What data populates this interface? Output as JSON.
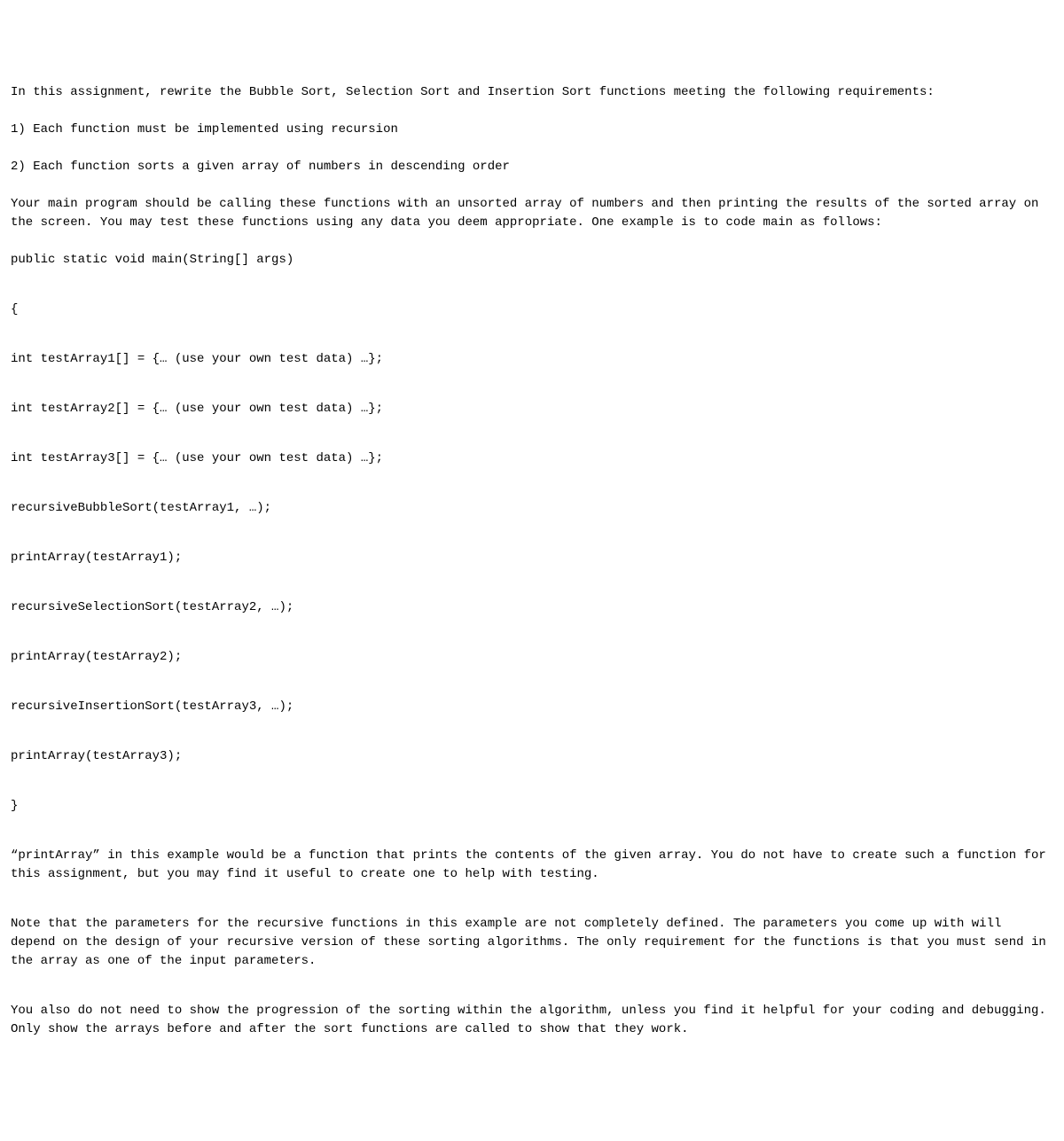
{
  "intro": {
    "line1": "In this assignment, rewrite the Bubble Sort, Selection Sort and Insertion Sort functions meeting the following requirements:",
    "line2": "1) Each function must be implemented using recursion",
    "line3": "2) Each function sorts a given array of numbers in descending order",
    "line4": "Your main program should be calling these functions with an unsorted array of numbers and then printing the results of the sorted array on the screen. You may test these functions using any data you deem appropriate. One example is to code main as follows:",
    "line5": "public static void main(String[] args)"
  },
  "code": {
    "open_brace": "{",
    "arr1": "int testArray1[] = {… (use your own test data) …};",
    "arr2": "int testArray2[] = {… (use your own test data) …};",
    "arr3": "int testArray3[] = {… (use your own test data) …};",
    "call1": "recursiveBubbleSort(testArray1, …);",
    "print1": "printArray(testArray1);",
    "call2": "recursiveSelectionSort(testArray2, …);",
    "print2": "printArray(testArray2);",
    "call3": "recursiveInsertionSort(testArray3, …);",
    "print3": "printArray(testArray3);",
    "close_brace": "}"
  },
  "notes": {
    "para1": "“printArray” in this example would be a function that prints the contents of the given array. You do not have to create such a function for this assignment, but you may find it useful to create one to help with testing.",
    "para2": "Note that the parameters for the recursive functions in this example are not completely defined. The parameters you come up with will depend on the design of your recursive version of these sorting algorithms. The only requirement for the functions is that you must send in the array as one of the input parameters.",
    "para3": "You also do not need to show the progression of the sorting within the algorithm, unless you find it helpful for your coding and debugging. Only show the arrays before and after the sort functions are called to show that they work."
  }
}
